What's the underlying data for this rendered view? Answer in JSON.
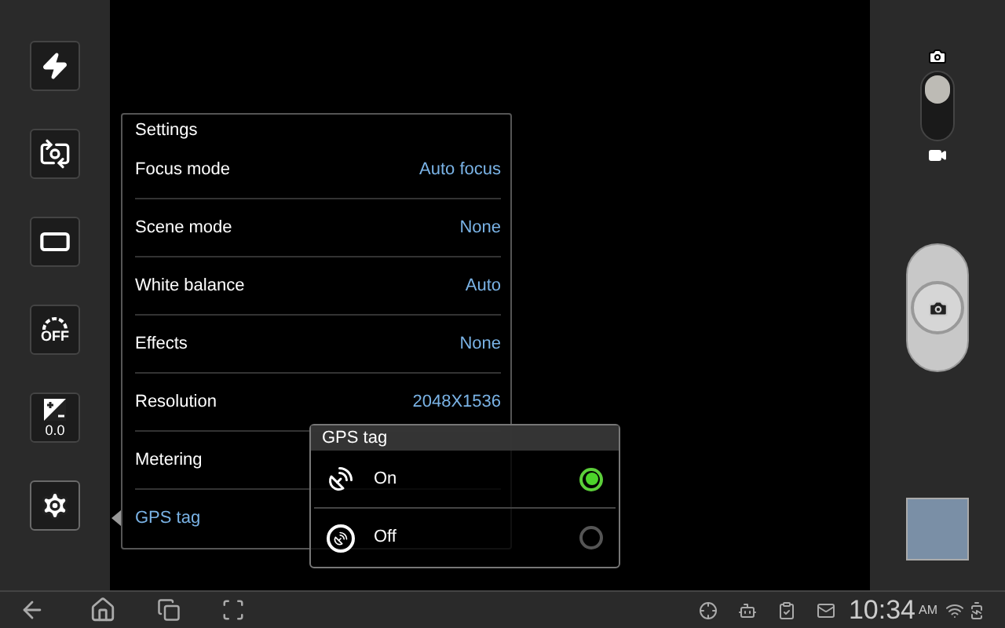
{
  "left_toolbar": [
    {
      "kind": "flash"
    },
    {
      "kind": "self-portrait"
    },
    {
      "kind": "shooting-mode"
    },
    {
      "kind": "timer",
      "text": "OFF"
    },
    {
      "kind": "exposure",
      "text": "0.0"
    },
    {
      "kind": "settings",
      "selected": true
    }
  ],
  "settings": {
    "title": "Settings",
    "items": [
      {
        "label": "Focus mode",
        "value": "Auto focus",
        "selected": false
      },
      {
        "label": "Scene mode",
        "value": "None",
        "selected": false
      },
      {
        "label": "White balance",
        "value": "Auto",
        "selected": false
      },
      {
        "label": "Effects",
        "value": "None",
        "selected": false
      },
      {
        "label": "Resolution",
        "value": "2048X1536",
        "selected": false
      },
      {
        "label": "Metering",
        "selected": false
      },
      {
        "label": "GPS tag",
        "selected": true
      }
    ]
  },
  "popup": {
    "title": "GPS tag",
    "options": [
      {
        "kind": "signal",
        "label": "On",
        "selected": true
      },
      {
        "kind": "no-signal",
        "label": "Off",
        "selected": false
      }
    ]
  },
  "mode_switch": {
    "photo_selected": true
  },
  "status_bar": {
    "time": "10:34",
    "ampm": "AM"
  }
}
